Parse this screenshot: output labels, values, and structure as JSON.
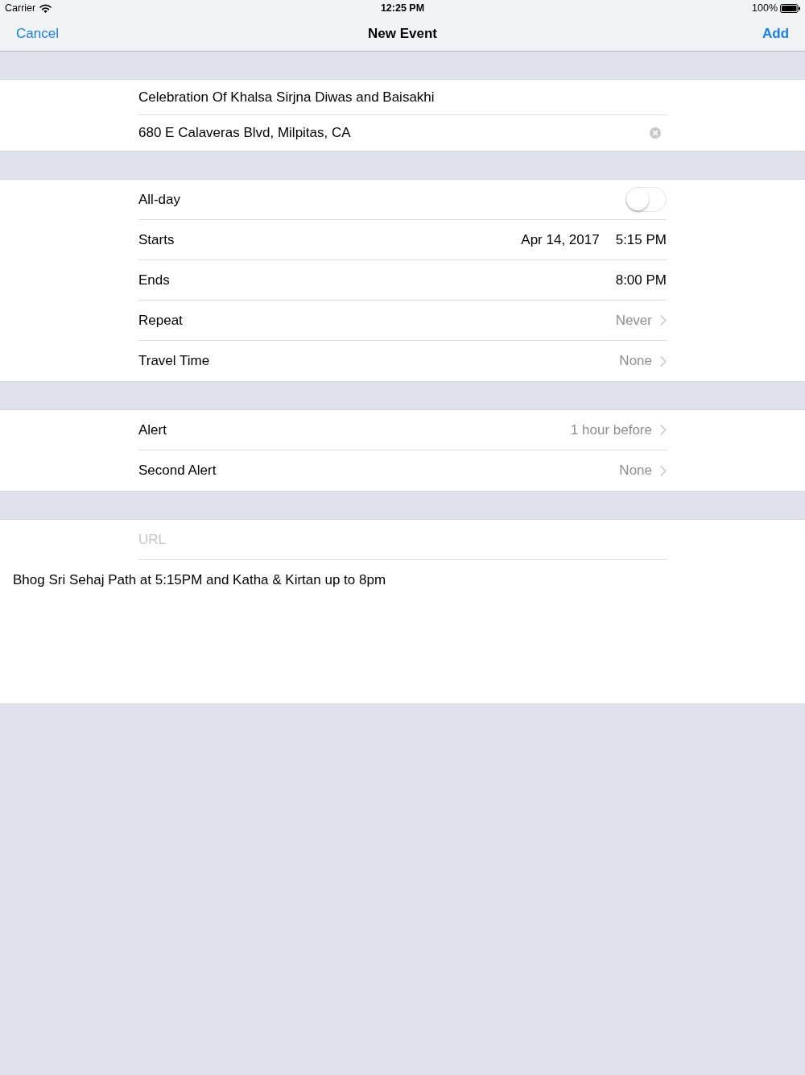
{
  "status_bar": {
    "carrier": "Carrier",
    "time": "12:25 PM",
    "battery": "100%"
  },
  "nav_bar": {
    "cancel": "Cancel",
    "title": "New Event",
    "add": "Add"
  },
  "title_field": {
    "value": "Celebration Of Khalsa Sirjna Diwas and Baisakhi"
  },
  "location_field": {
    "value": "680 E Calaveras Blvd, Milpitas, CA"
  },
  "time_rows": [
    {
      "kind": "switch",
      "label": "All-day",
      "on": false
    },
    {
      "kind": "datetime",
      "label": "Starts",
      "date": "Apr 14, 2017",
      "time": "5:15 PM"
    },
    {
      "kind": "datetime",
      "label": "Ends",
      "time": "8:00 PM"
    },
    {
      "kind": "disclosure",
      "label": "Repeat",
      "value": "Never"
    },
    {
      "kind": "disclosure",
      "label": "Travel Time",
      "value": "None"
    }
  ],
  "alert_rows": [
    {
      "kind": "disclosure",
      "label": "Alert",
      "value": "1 hour before"
    },
    {
      "kind": "disclosure",
      "label": "Second Alert",
      "value": "None"
    }
  ],
  "url_field": {
    "placeholder": "URL"
  },
  "notes": {
    "value": "Bhog Sri Sehaj Path at 5:15PM and Katha & Kirtan up to 8pm"
  }
}
